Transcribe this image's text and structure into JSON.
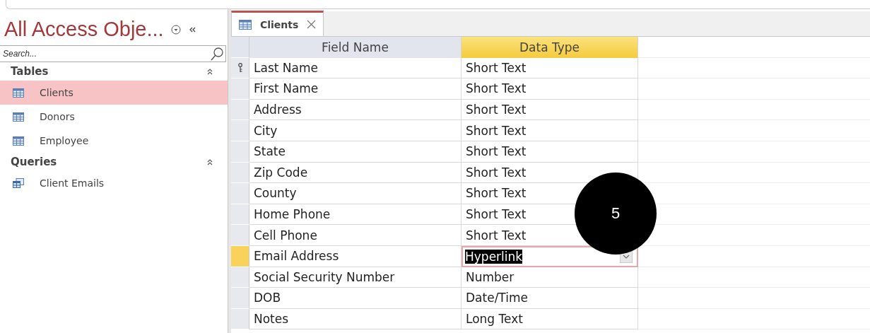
{
  "nav_pane": {
    "title": "All Access Obje...",
    "search": {
      "placeholder": "Search..."
    },
    "groups": [
      {
        "label": "Tables",
        "expanded": true,
        "items": [
          {
            "label": "Clients",
            "kind": "table",
            "selected": true
          },
          {
            "label": "Donors",
            "kind": "table",
            "selected": false
          },
          {
            "label": "Employee",
            "kind": "table",
            "selected": false
          }
        ]
      },
      {
        "label": "Queries",
        "expanded": true,
        "items": [
          {
            "label": "Client Emails",
            "kind": "query",
            "selected": false
          }
        ]
      }
    ]
  },
  "tabs": [
    {
      "label": "Clients",
      "selected": true
    }
  ],
  "design_grid": {
    "columns": [
      {
        "label": "Field Name",
        "selected": false
      },
      {
        "label": "Data Type",
        "selected": true
      }
    ],
    "rows": [
      {
        "field": "Last Name",
        "type": "Short Text",
        "primary_key": true,
        "selected": false,
        "editing": false
      },
      {
        "field": "First Name",
        "type": "Short Text",
        "primary_key": false,
        "selected": false,
        "editing": false
      },
      {
        "field": "Address",
        "type": "Short Text",
        "primary_key": false,
        "selected": false,
        "editing": false
      },
      {
        "field": "City",
        "type": "Short Text",
        "primary_key": false,
        "selected": false,
        "editing": false
      },
      {
        "field": "State",
        "type": "Short Text",
        "primary_key": false,
        "selected": false,
        "editing": false
      },
      {
        "field": "Zip Code",
        "type": "Short Text",
        "primary_key": false,
        "selected": false,
        "editing": false
      },
      {
        "field": "County",
        "type": "Short Text",
        "primary_key": false,
        "selected": false,
        "editing": false
      },
      {
        "field": "Home Phone",
        "type": "Short Text",
        "primary_key": false,
        "selected": false,
        "editing": false
      },
      {
        "field": "Cell Phone",
        "type": "Short Text",
        "primary_key": false,
        "selected": false,
        "editing": false
      },
      {
        "field": "Email Address",
        "type": "Hyperlink",
        "primary_key": false,
        "selected": true,
        "editing": true
      },
      {
        "field": "Social Security Number",
        "type": "Number",
        "primary_key": false,
        "selected": false,
        "editing": false
      },
      {
        "field": "DOB",
        "type": "Date/Time",
        "primary_key": false,
        "selected": false,
        "editing": false
      },
      {
        "field": "Notes",
        "type": "Long Text",
        "primary_key": false,
        "selected": false,
        "editing": false
      }
    ]
  },
  "step_badge": "5"
}
